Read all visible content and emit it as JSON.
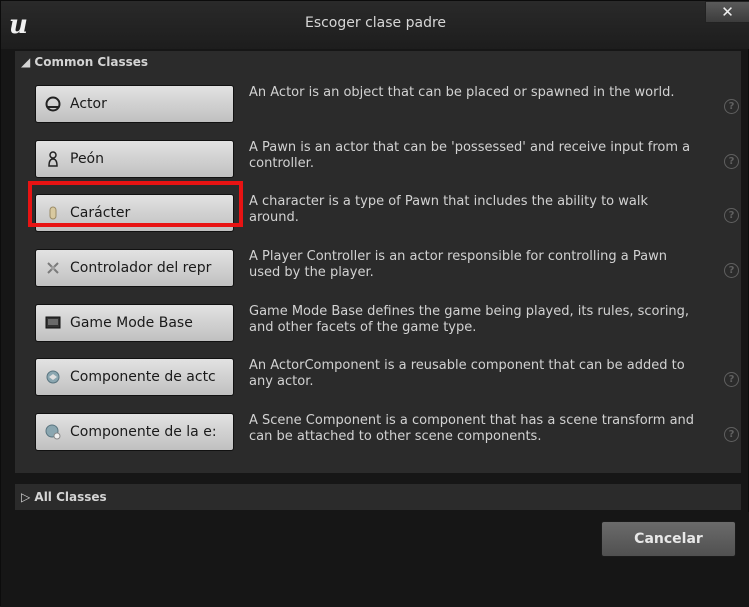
{
  "window": {
    "title": "Escoger clase padre",
    "close_label": "✕"
  },
  "common_classes": {
    "header": "◢ Common Classes",
    "items": [
      {
        "label": "Actor",
        "icon": "actor-icon",
        "description": "An Actor is an object that can be placed or spawned in the world.",
        "help": "?"
      },
      {
        "label": "Peón",
        "icon": "pawn-icon",
        "description": "A Pawn is an actor that can be 'possessed' and receive input from a controller.",
        "help": "?"
      },
      {
        "label": "Carácter",
        "icon": "character-icon",
        "description": "A character is a type of Pawn that includes the ability to walk around.",
        "help": "?"
      },
      {
        "label": "Controlador del repr",
        "icon": "player-controller-icon",
        "description": "A Player Controller is an actor responsible for controlling a Pawn used by the player.",
        "help": "?"
      },
      {
        "label": "Game Mode Base",
        "icon": "game-mode-icon",
        "description": "Game Mode Base defines the game being played, its rules, scoring, and other facets of the game type.",
        "help": ""
      },
      {
        "label": "Componente de actc",
        "icon": "actor-component-icon",
        "description": "An ActorComponent is a reusable component that can be added to any actor.",
        "help": "?"
      },
      {
        "label": "Componente de la e:",
        "icon": "scene-component-icon",
        "description": "A Scene Component is a component that has a scene transform and can be attached to other scene components.",
        "help": "?"
      }
    ]
  },
  "all_classes": {
    "header": "▷ All Classes"
  },
  "footer": {
    "cancel_label": "Cancelar"
  },
  "colors": {
    "highlight": "#e81313",
    "background": "#161616",
    "panel": "#2b2b2b"
  }
}
